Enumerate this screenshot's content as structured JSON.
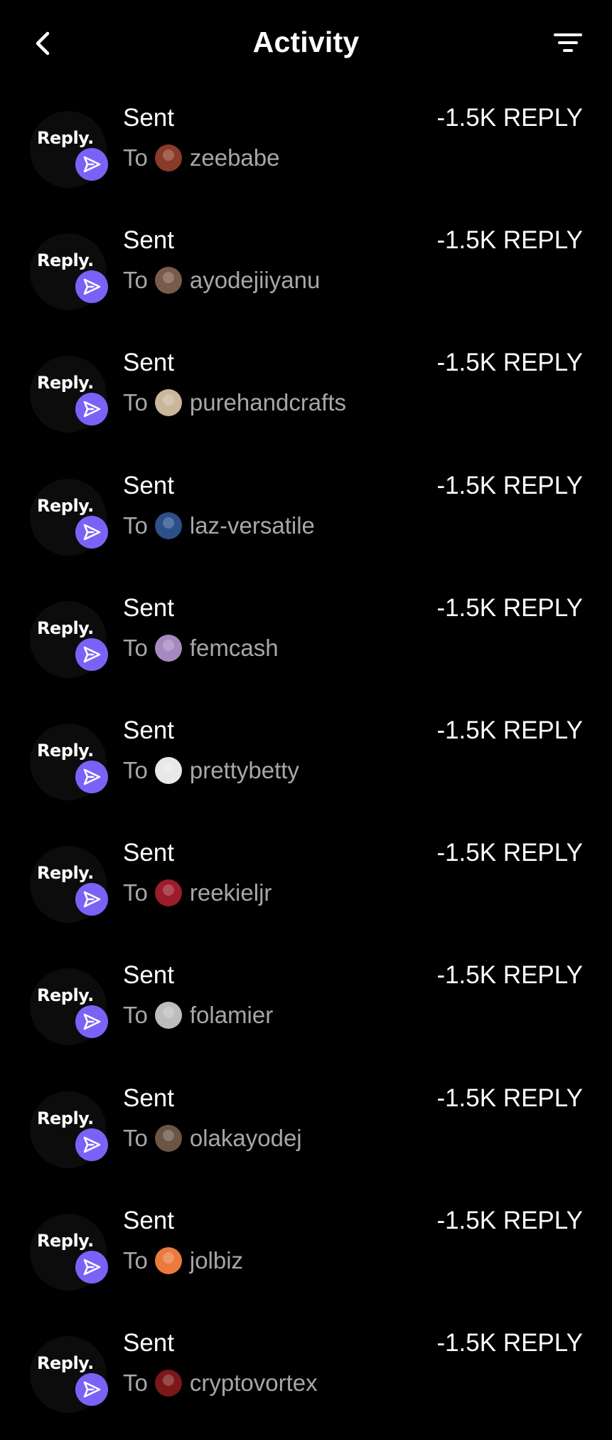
{
  "header": {
    "title": "Activity",
    "back_icon": "chevron-left-icon",
    "filter_icon": "filter-icon"
  },
  "colors": {
    "background": "#000000",
    "badge": "#7b62f7",
    "secondary_text": "#a7a7ab"
  },
  "logo_text": "Reply.",
  "activities": [
    {
      "title": "Sent",
      "to_label": "To",
      "recipient": "zeebabe",
      "amount": "-1.5K REPLY",
      "avatar_color": "#8a3a28"
    },
    {
      "title": "Sent",
      "to_label": "To",
      "recipient": "ayodejiiyanu",
      "amount": "-1.5K REPLY",
      "avatar_color": "#7a5a4a"
    },
    {
      "title": "Sent",
      "to_label": "To",
      "recipient": "purehandcrafts",
      "amount": "-1.5K REPLY",
      "avatar_color": "#c9b79a"
    },
    {
      "title": "Sent",
      "to_label": "To",
      "recipient": "laz-versatile",
      "amount": "-1.5K REPLY",
      "avatar_color": "#2d4f8a"
    },
    {
      "title": "Sent",
      "to_label": "To",
      "recipient": "femcash",
      "amount": "-1.5K REPLY",
      "avatar_color": "#a58ac0"
    },
    {
      "title": "Sent",
      "to_label": "To",
      "recipient": "prettybetty",
      "amount": "-1.5K REPLY",
      "avatar_color": "#e8e8e8"
    },
    {
      "title": "Sent",
      "to_label": "To",
      "recipient": "reekieljr",
      "amount": "-1.5K REPLY",
      "avatar_color": "#9b1c2a"
    },
    {
      "title": "Sent",
      "to_label": "To",
      "recipient": "folamier",
      "amount": "-1.5K REPLY",
      "avatar_color": "#bdbdbd"
    },
    {
      "title": "Sent",
      "to_label": "To",
      "recipient": "olakayodej",
      "amount": "-1.5K REPLY",
      "avatar_color": "#6b5544"
    },
    {
      "title": "Sent",
      "to_label": "To",
      "recipient": "jolbiz",
      "amount": "-1.5K REPLY",
      "avatar_color": "#ec7a3d"
    },
    {
      "title": "Sent",
      "to_label": "To",
      "recipient": "cryptovortex",
      "amount": "-1.5K REPLY",
      "avatar_color": "#7a1818"
    }
  ]
}
